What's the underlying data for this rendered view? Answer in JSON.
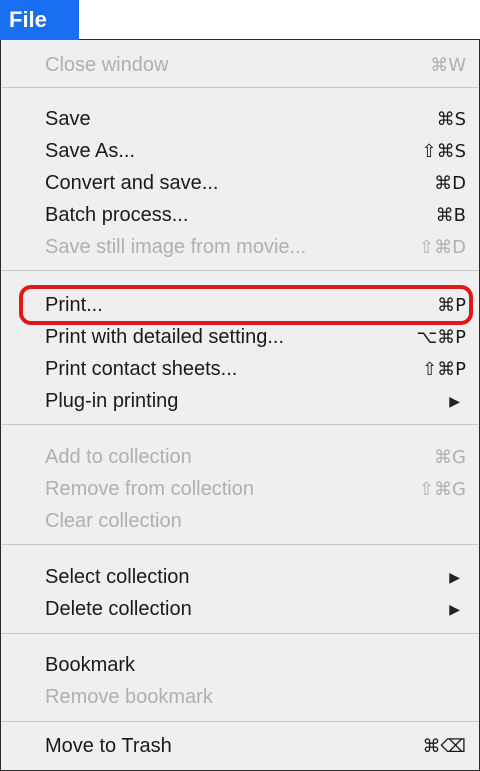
{
  "menu": {
    "title": "File",
    "items": [
      {
        "label": "Close window",
        "shortcut": "⌘W",
        "enabled": false
      },
      {
        "label": "Save",
        "shortcut": "⌘S",
        "enabled": true
      },
      {
        "label": "Save As...",
        "shortcut": "⇧⌘S",
        "enabled": true
      },
      {
        "label": "Convert and save...",
        "shortcut": "⌘D",
        "enabled": true
      },
      {
        "label": "Batch process...",
        "shortcut": "⌘B",
        "enabled": true
      },
      {
        "label": "Save still image from movie...",
        "shortcut": "⇧⌘D",
        "enabled": false
      },
      {
        "label": "Print...",
        "shortcut": "⌘P",
        "enabled": true,
        "highlighted": true
      },
      {
        "label": "Print with detailed setting...",
        "shortcut": "⌥⌘P",
        "enabled": true
      },
      {
        "label": "Print contact sheets...",
        "shortcut": "⇧⌘P",
        "enabled": true
      },
      {
        "label": "Plug-in printing",
        "submenu_icon": "chevron-right-icon",
        "enabled": true
      },
      {
        "label": "Add to collection",
        "shortcut": "⌘G",
        "enabled": false
      },
      {
        "label": "Remove from collection",
        "shortcut": "⇧⌘G",
        "enabled": false
      },
      {
        "label": "Clear collection",
        "enabled": false
      },
      {
        "label": "Select collection",
        "submenu_icon": "chevron-right-icon",
        "enabled": true
      },
      {
        "label": "Delete collection",
        "submenu_icon": "chevron-right-icon",
        "enabled": true
      },
      {
        "label": "Bookmark",
        "enabled": true
      },
      {
        "label": "Remove bookmark",
        "enabled": false
      },
      {
        "label": "Move to Trash",
        "shortcut": "⌘⌫",
        "enabled": true
      }
    ],
    "submenu_arrow": "▶"
  },
  "colors": {
    "menu_title_bg": "#1a6ff0",
    "menu_bg": "#efefef",
    "disabled_text": "#b0b0b0",
    "highlight_border": "#e01818"
  }
}
